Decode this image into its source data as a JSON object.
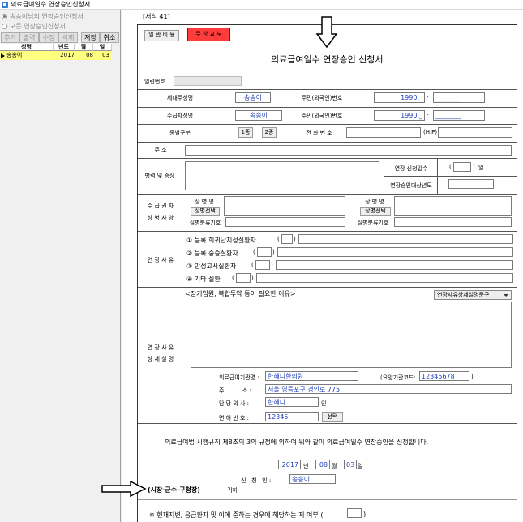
{
  "window": {
    "title": "의료급여일수 연장승인신청서"
  },
  "left": {
    "radio_1": "송송이님의 연장승인신청서",
    "radio_2": "모든 연장승인신청서",
    "buttons": [
      "추가",
      "출력",
      "수정",
      "삭제",
      "저장",
      "취소"
    ],
    "grid_headers": [
      "성명",
      "년도",
      "월",
      "일"
    ],
    "grid_row": {
      "name": "송송이",
      "year": "2017",
      "month": "08",
      "day": "03"
    }
  },
  "doc": {
    "form_number": "[서식 41]",
    "btn_fee": "일 반 비 용",
    "btn_free": "무 상 교 부",
    "title": "의료급여일수 연장승인 신청서",
    "serial_label": "일련번호",
    "row1": {
      "label_a": "세대주성명",
      "value_a": "송송이",
      "label_b": "주민(외국인)번호",
      "value_b": "1990._",
      "dash": "-",
      "value_c": "________"
    },
    "row2": {
      "label_a": "수급자성명",
      "value_a": "송송이",
      "label_b": "주민(외국인)번호",
      "value_b": "1990._",
      "dash": "-",
      "value_c": "________"
    },
    "row3": {
      "label": "종별구분",
      "type1": "1종",
      "dot": "·",
      "type2": "2종",
      "phone_label": "전 화 번 호",
      "mobile_label": "(H.P)"
    },
    "address_label": "주 소",
    "disease_label": "병력 및 증상",
    "ext_days_label": "연장 신청일수",
    "ext_days_open": "(",
    "ext_days_close": ")",
    "ext_days_unit": "일",
    "ext_year_label": "연장승인대상년도",
    "illness": {
      "section_label_1": "수 급 권 자",
      "section_label_2": "상 병 사 항",
      "name_label": "상 병 명",
      "select_button": "상병선택",
      "code_label": "질병분류기호"
    },
    "reason": {
      "section_label": "연 장 사 유",
      "items": [
        {
          "text": "① 등록 희귀난치성질환자",
          "open": "(",
          "close": ")"
        },
        {
          "text": "② 등록 중증질환자",
          "open": "(",
          "close": ")"
        },
        {
          "text": "③ 만성고시질환자",
          "open": "(",
          "close": ")"
        },
        {
          "text": "④ 기타 질환",
          "open": "(",
          "close": ")"
        }
      ]
    },
    "detail": {
      "section_label_1": "연 장 사 유",
      "section_label_2": "상 세 설 명",
      "prompt": "<장기입원, 복합투약 등이 필요한 이유>",
      "dropdown": "연장사유상세설명문구",
      "facility_label": "의료급여기관명 :",
      "facility_value": "한혜디한의원",
      "code_label": "(요양기관코드:",
      "code_value": "12345678",
      "code_close": ")",
      "address_label": "주          소 :",
      "address_value": "서울 영등포구 경인로 775",
      "doctor_label": "담 당 의 사 :",
      "doctor_value": "한혜디",
      "doctor_suffix": "인",
      "license_label": "면 허 번 호 :",
      "license_value": "12345",
      "license_button": "선택"
    },
    "statement": "의료급여법 시행규칙 제8조의 3의 규정에 의하여 위와 같이 의료급여일수 연장승인을 신청합니다.",
    "date": {
      "year": "2017",
      "year_unit": "년",
      "month": "08",
      "month_unit": "월",
      "day": "03",
      "day_unit": "일"
    },
    "applicant_label": "신   청   인 :",
    "applicant_value": "송송이",
    "addressee": "(시장·군수·구청장)",
    "addressee_suffix": "귀하",
    "footnote": "※ 현재지변, 응급환자 및 이에 준하는 경우에 해당하는 지 여부 (",
    "footnote_close": ")"
  },
  "colors": {
    "accent_red": "#ff3b3b",
    "selected_row": "#ffff80",
    "value_blue": "#1f3fb8"
  },
  "icons": [
    "app-icon",
    "down-arrow-annotation-icon",
    "right-arrow-annotation-icon",
    "dropdown-caret-icon",
    "row-pointer-icon"
  ]
}
